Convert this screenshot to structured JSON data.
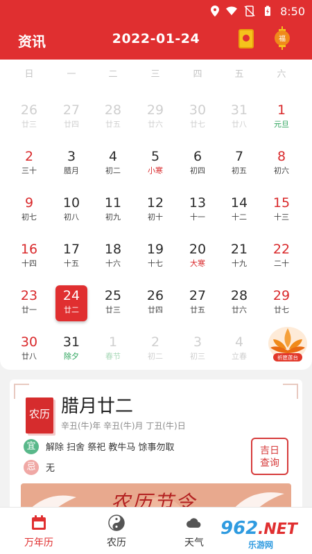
{
  "status_bar": {
    "time": "8:50"
  },
  "header": {
    "left_link": "资讯",
    "date": "2022-01-24",
    "red_packet_icon": "red-envelope-icon",
    "lantern_icon": "lantern-icon",
    "lantern_char": "福"
  },
  "calendar": {
    "weekdays": [
      "日",
      "一",
      "二",
      "三",
      "四",
      "五",
      "六"
    ],
    "weeks": [
      [
        {
          "day": "26",
          "lunar": "廿三",
          "other": true
        },
        {
          "day": "27",
          "lunar": "廿四",
          "other": true
        },
        {
          "day": "28",
          "lunar": "廿五",
          "other": true
        },
        {
          "day": "29",
          "lunar": "廿六",
          "other": true
        },
        {
          "day": "30",
          "lunar": "廿七",
          "other": true
        },
        {
          "day": "31",
          "lunar": "廿八",
          "other": true
        },
        {
          "day": "1",
          "lunar": "元旦",
          "weekend": true,
          "fest": true
        }
      ],
      [
        {
          "day": "2",
          "lunar": "三十",
          "weekend": true
        },
        {
          "day": "3",
          "lunar": "腊月"
        },
        {
          "day": "4",
          "lunar": "初二"
        },
        {
          "day": "5",
          "lunar": "小寒",
          "term": true
        },
        {
          "day": "6",
          "lunar": "初四"
        },
        {
          "day": "7",
          "lunar": "初五"
        },
        {
          "day": "8",
          "lunar": "初六",
          "weekend": true
        }
      ],
      [
        {
          "day": "9",
          "lunar": "初七",
          "weekend": true
        },
        {
          "day": "10",
          "lunar": "初八"
        },
        {
          "day": "11",
          "lunar": "初九"
        },
        {
          "day": "12",
          "lunar": "初十"
        },
        {
          "day": "13",
          "lunar": "十一"
        },
        {
          "day": "14",
          "lunar": "十二"
        },
        {
          "day": "15",
          "lunar": "十三",
          "weekend": true
        }
      ],
      [
        {
          "day": "16",
          "lunar": "十四",
          "weekend": true
        },
        {
          "day": "17",
          "lunar": "十五"
        },
        {
          "day": "18",
          "lunar": "十六"
        },
        {
          "day": "19",
          "lunar": "十七"
        },
        {
          "day": "20",
          "lunar": "大寒",
          "term": true
        },
        {
          "day": "21",
          "lunar": "十九"
        },
        {
          "day": "22",
          "lunar": "二十",
          "weekend": true
        }
      ],
      [
        {
          "day": "23",
          "lunar": "廿一",
          "weekend": true
        },
        {
          "day": "24",
          "lunar": "廿二",
          "today": true
        },
        {
          "day": "25",
          "lunar": "廿三"
        },
        {
          "day": "26",
          "lunar": "廿四"
        },
        {
          "day": "27",
          "lunar": "廿五"
        },
        {
          "day": "28",
          "lunar": "廿六"
        },
        {
          "day": "29",
          "lunar": "廿七",
          "weekend": true
        }
      ],
      [
        {
          "day": "30",
          "lunar": "廿八",
          "weekend": true
        },
        {
          "day": "31",
          "lunar": "除夕",
          "fest": true
        },
        {
          "day": "1",
          "lunar": "春节",
          "other": true,
          "fest": true
        },
        {
          "day": "2",
          "lunar": "初二",
          "other": true
        },
        {
          "day": "3",
          "lunar": "初三",
          "other": true
        },
        {
          "day": "4",
          "lunar": "立春",
          "other": true
        },
        null
      ]
    ],
    "lotus_label": "祈愿莲台",
    "lotus_icon": "lotus-icon"
  },
  "almanac": {
    "seal": "农历",
    "lunar_date": "腊月廿二",
    "ganzhi": "辛丑(牛)年 辛丑(牛)月 丁丑(牛)日",
    "yi_label": "宜",
    "yi_text": "解除 扫舍 祭祀 教牛马 馀事勿取",
    "ji_label": "忌",
    "ji_text": "无",
    "stamp_line1": "吉日",
    "stamp_line2": "查询",
    "banner_text": "农历节令"
  },
  "tabs": [
    {
      "label": "万年历",
      "icon": "calendar-icon",
      "active": true
    },
    {
      "label": "农历",
      "icon": "yin-yang-icon"
    },
    {
      "label": "天气",
      "icon": "cloud-icon"
    }
  ],
  "watermark": {
    "brand": "962",
    "net": ".NET",
    "sub": "乐游网"
  },
  "colors": {
    "primary": "#e02f30",
    "festival": "#2aa35a",
    "muted": "#cfcfcf"
  }
}
